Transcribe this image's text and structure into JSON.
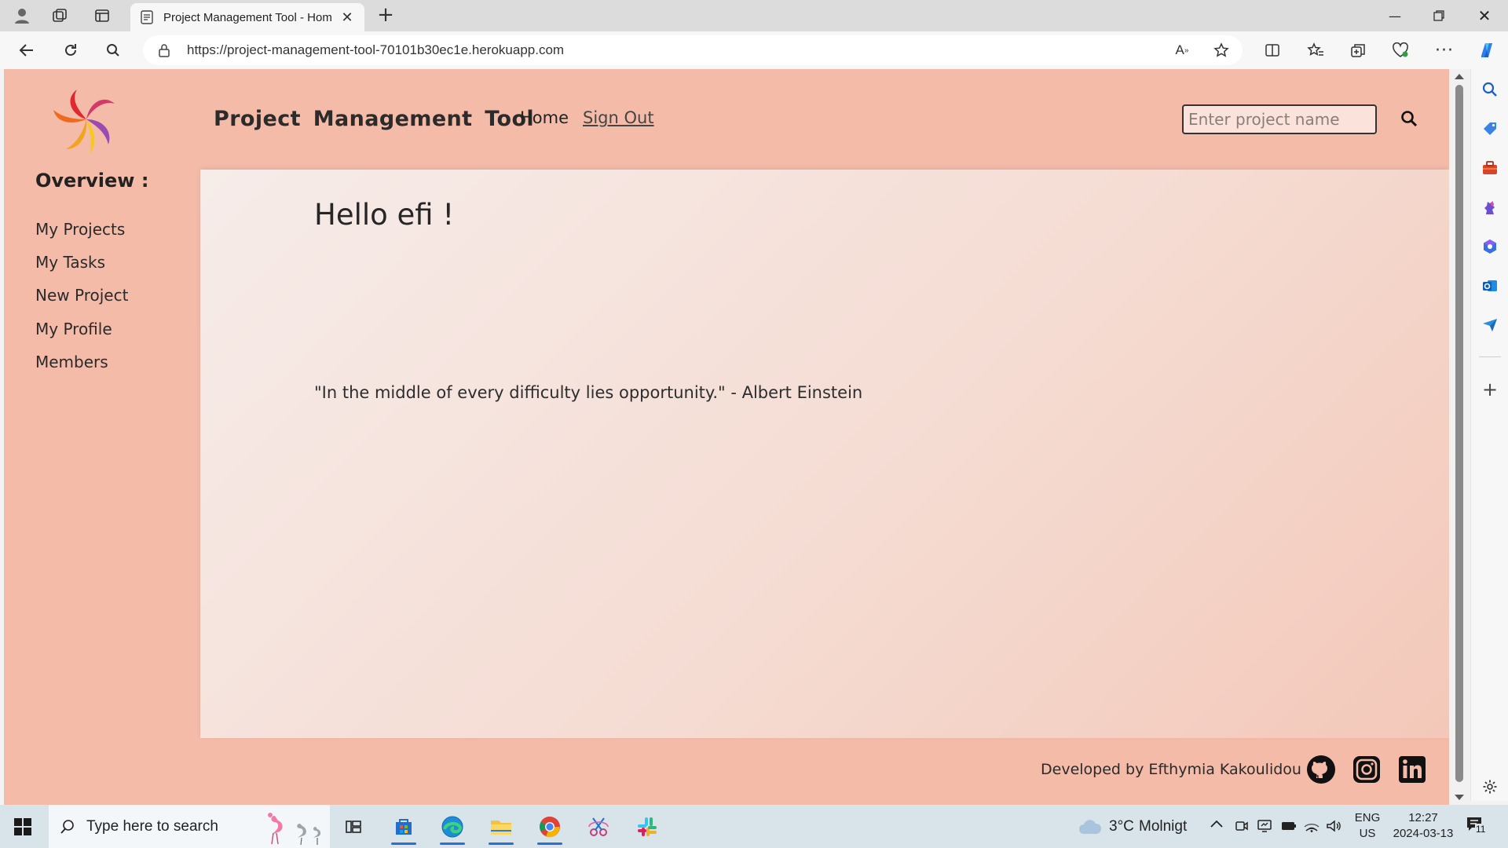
{
  "browser": {
    "tab_title": "Project Management Tool - Hom",
    "url": "https://project-management-tool-70101b30ec1e.herokuapp.com"
  },
  "header": {
    "brand": "Project Management Tool",
    "nav_home": "Home",
    "nav_signout": "Sign Out",
    "search_placeholder": "Enter project name"
  },
  "sidebar": {
    "heading": "Overview :",
    "items": [
      {
        "label": "My Projects"
      },
      {
        "label": "My Tasks"
      },
      {
        "label": "New Project"
      },
      {
        "label": "My Profile"
      },
      {
        "label": "Members"
      }
    ]
  },
  "main": {
    "greeting": "Hello efi !",
    "quote": "\"In the middle of every difficulty lies opportunity.\" - Albert Einstein"
  },
  "footer": {
    "credit": "Developed by Efthymia Kakoulidou",
    "icons": [
      "github-icon",
      "instagram-icon",
      "linkedin-icon"
    ]
  },
  "taskbar": {
    "search_placeholder": "Type here to search",
    "weather_temp": "3°C",
    "weather_desc": "Molnigt",
    "lang": "ENG",
    "region": "US",
    "time": "12:27",
    "date": "2024-03-13",
    "notifications": "11"
  },
  "colors": {
    "page_bg": "#f4bba9",
    "accent_blue": "#2a6fd6"
  }
}
